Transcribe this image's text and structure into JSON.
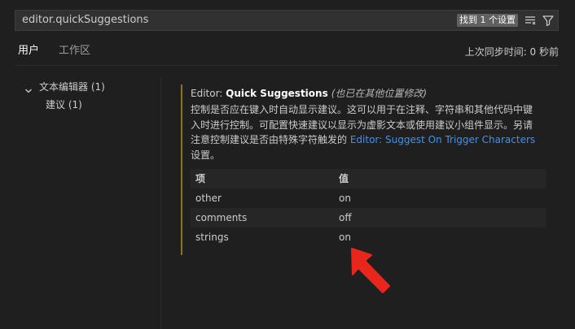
{
  "search": {
    "value": "editor.quickSuggestions",
    "result_badge": "找到 1 个设置"
  },
  "tabs": [
    {
      "label": "用户",
      "active": true
    },
    {
      "label": "工作区",
      "active": false
    }
  ],
  "sync_status": "上次同步时间: 0 秒前",
  "toc": [
    {
      "label": "文本编辑器 (1)",
      "expanded": true
    },
    {
      "label": "建议 (1)"
    }
  ],
  "setting": {
    "category": "Editor: ",
    "name": "Quick Suggestions",
    "modified_note": "(也已在其他位置修改)",
    "desc_before": "控制是否应在键入时自动显示建议。这可以用于在注释、字符串和其他代码中键入时进行控制。可配置快速建议以显示为虚影文本或使用建议小组件显示。另请注意控制建议是否由特殊字符触发的 ",
    "desc_link": "Editor: Suggest On Trigger Characters",
    "desc_after": " 设置。",
    "table": {
      "header_item": "项",
      "header_value": "值",
      "rows": [
        {
          "item": "other",
          "value": "on"
        },
        {
          "item": "comments",
          "value": "off"
        },
        {
          "item": "strings",
          "value": "on"
        }
      ]
    }
  },
  "colors": {
    "background": "#1f1f1f",
    "link": "#3794ff",
    "modified_bar": "#8a7224",
    "annotation_arrow": "#e8261c"
  }
}
